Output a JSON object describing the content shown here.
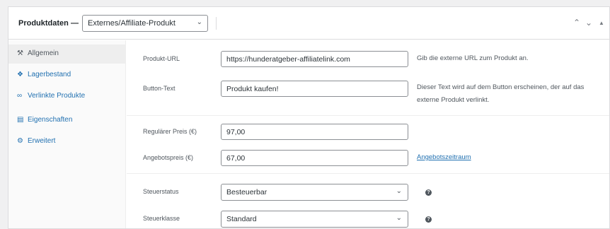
{
  "header": {
    "title": "Produktdaten —",
    "product_type": "Externes/Affiliate-Produkt",
    "move_up_icon": "chevron-up",
    "move_down_icon": "chevron-down",
    "toggle_icon": "triangle-up"
  },
  "sidebar": {
    "items": [
      {
        "label": "Allgemein",
        "icon": "wrench-icon",
        "active": true
      },
      {
        "label": "Lagerbestand",
        "icon": "tag-icon",
        "active": false
      },
      {
        "label": "Verlinkte Produkte",
        "icon": "link-icon",
        "active": false
      },
      {
        "label": "Eigenschaften",
        "icon": "table-icon",
        "active": false
      },
      {
        "label": "Erweitert",
        "icon": "gear-icon",
        "active": false
      }
    ]
  },
  "fields": {
    "product_url": {
      "label": "Produkt-URL",
      "value": "https://hunderatgeber-affiliatelink.com",
      "description": "Gib die externe URL zum Produkt an."
    },
    "button_text": {
      "label": "Button-Text",
      "value": "Produkt kaufen!",
      "description_line1": "Dieser Text wird auf dem Button erscheinen, der auf das",
      "description_line2": "externe Produkt verlinkt."
    },
    "regular_price": {
      "label": "Regulärer Preis (€)",
      "value": "97,00"
    },
    "sale_price": {
      "label": "Angebotspreis (€)",
      "value": "67,00",
      "link": "Angebotszeitraum"
    },
    "tax_status": {
      "label": "Steuerstatus",
      "value": "Besteuerbar"
    },
    "tax_class": {
      "label": "Steuerklasse",
      "value": "Standard"
    }
  },
  "colors": {
    "link": "#2271b1",
    "active_tab_bg": "#eeeeee",
    "border": "#dcdcde"
  }
}
